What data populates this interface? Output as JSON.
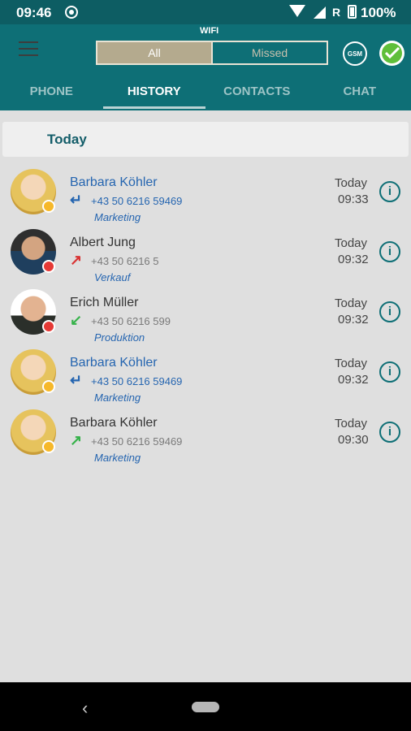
{
  "status_bar": {
    "time": "09:46",
    "roaming": "R",
    "battery": "100%"
  },
  "header": {
    "network": "WIFI",
    "filter": {
      "all": "All",
      "missed": "Missed"
    },
    "gsm": "GSM"
  },
  "tabs": [
    "PHONE",
    "HISTORY",
    "CONTACTS",
    "CHAT"
  ],
  "section": {
    "title": "Today"
  },
  "calls": [
    {
      "name": "Barbara Köhler",
      "number": "+43 50 6216 59469",
      "department": "Marketing",
      "day": "Today",
      "time": "09:33",
      "direction": "forwarded",
      "status": "yellow"
    },
    {
      "name": "Albert Jung",
      "number": "+43 50 6216 5",
      "department": "Verkauf",
      "day": "Today",
      "time": "09:32",
      "direction": "outgoing",
      "status": "red"
    },
    {
      "name": "Erich Müller",
      "number": "+43 50 6216 599",
      "department": "Produktion",
      "day": "Today",
      "time": "09:32",
      "direction": "incoming",
      "status": "red"
    },
    {
      "name": "Barbara Köhler",
      "number": "+43 50 6216 59469",
      "department": "Marketing",
      "day": "Today",
      "time": "09:32",
      "direction": "forwarded",
      "status": "yellow"
    },
    {
      "name": "Barbara Köhler",
      "number": "+43 50 6216 59469",
      "department": "Marketing",
      "day": "Today",
      "time": "09:30",
      "direction": "outgoing",
      "status": "yellow"
    }
  ],
  "colors": {
    "accent": "#0e6f76",
    "link": "#2565b0",
    "background": "#dfdfdf"
  }
}
